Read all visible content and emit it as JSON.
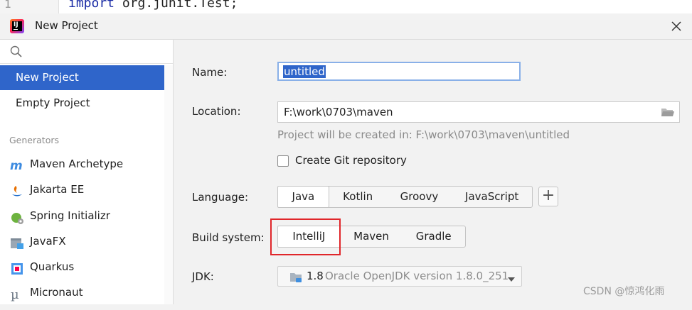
{
  "editor": {
    "line_number": "1",
    "keyword": "import",
    "code_rest": " org.junit.",
    "class_name": "Test",
    "semicolon": ";"
  },
  "window": {
    "title": "New Project",
    "close_icon": "close-icon",
    "app_icon": "intellij-idea-icon"
  },
  "sidebar": {
    "search_placeholder": "",
    "items": [
      {
        "label": "New Project",
        "selected": true
      },
      {
        "label": "Empty Project",
        "selected": false
      }
    ],
    "generators_header": "Generators",
    "generators": [
      {
        "label": "Maven Archetype",
        "icon": "maven-icon"
      },
      {
        "label": "Jakarta EE",
        "icon": "jakarta-ee-icon"
      },
      {
        "label": "Spring Initializr",
        "icon": "spring-icon"
      },
      {
        "label": "JavaFX",
        "icon": "javafx-icon"
      },
      {
        "label": "Quarkus",
        "icon": "quarkus-icon"
      },
      {
        "label": "Micronaut",
        "icon": "micronaut-icon"
      }
    ]
  },
  "form": {
    "name_label": "Name:",
    "name_value": "untitled",
    "location_label": "Location:",
    "location_value": "F:\\work\\0703\\maven",
    "location_hint": "Project will be created in: F:\\work\\0703\\maven\\untitled",
    "git_checkbox_label": "Create Git repository",
    "git_checked": false,
    "language_label": "Language:",
    "languages": [
      "Java",
      "Kotlin",
      "Groovy",
      "JavaScript"
    ],
    "language_selected": "Java",
    "add_language_label": "+",
    "build_label": "Build system:",
    "build_systems": [
      "IntelliJ",
      "Maven",
      "Gradle"
    ],
    "build_selected": "IntelliJ",
    "jdk_label": "JDK:",
    "jdk_version": "1.8",
    "jdk_detail": "Oracle OpenJDK version 1.8.0_251"
  },
  "colors": {
    "selection": "#2f65ca",
    "highlight_box": "#e0262a",
    "keyword": "#1a2ba5"
  },
  "watermark": "CSDN @惊鸿化雨"
}
